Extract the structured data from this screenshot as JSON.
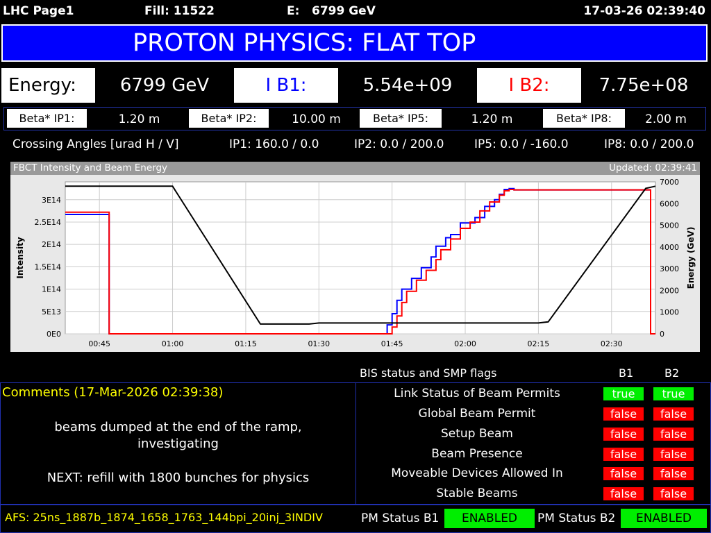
{
  "header": {
    "page": "LHC Page1",
    "fill": "Fill: 11522",
    "energy_label": "E:",
    "energy_value": "6799 GeV",
    "datetime": "17-03-26 02:39:40"
  },
  "title": "PROTON PHYSICS: FLAT TOP",
  "energy_row": {
    "energy_label": "Energy:",
    "energy_value": "6799 GeV",
    "ib1_label": "I B1:",
    "ib1_value": "5.54e+09",
    "ib2_label": "I B2:",
    "ib2_value": "7.75e+08"
  },
  "beta": [
    {
      "label": "Beta* IP1:",
      "value": "1.20 m"
    },
    {
      "label": "Beta* IP2:",
      "value": "10.00 m"
    },
    {
      "label": "Beta* IP5:",
      "value": "1.20 m"
    },
    {
      "label": "Beta* IP8:",
      "value": "2.00 m"
    }
  ],
  "crossing": {
    "label": "Crossing Angles [urad H / V]",
    "ip1": "IP1: 160.0 / 0.0",
    "ip2": "IP2: 0.0 / 200.0",
    "ip5": "IP5: 0.0 / -160.0",
    "ip8": "IP8: 0.0 / 200.0"
  },
  "chart_header": {
    "title": "FBCT Intensity and Beam Energy",
    "updated": "Updated: 02:39:41"
  },
  "chart_data": {
    "type": "line",
    "xlabel": "",
    "ylabel": "Intensity",
    "y2label": "Energy (GeV)",
    "xlim": [
      "00:38",
      "02:39"
    ],
    "ylim": [
      0,
      340000000000000.0
    ],
    "y2lim": [
      0,
      7000
    ],
    "grid": true,
    "x_ticks": [
      "00:45",
      "01:00",
      "01:15",
      "01:30",
      "01:45",
      "02:00",
      "02:15",
      "02:30"
    ],
    "y_ticks": [
      "0E0",
      "5E13",
      "1E14",
      "1.5E14",
      "2E14",
      "2.5E14",
      "3E14"
    ],
    "y2_ticks": [
      "0",
      "1000",
      "2000",
      "3000",
      "4000",
      "5000",
      "6000",
      "7000"
    ],
    "colors": {
      "b1": "#0000ff",
      "b2": "#ff0000",
      "energy": "#000000"
    },
    "series": [
      {
        "axis": "y",
        "color": "b1",
        "x": [
          "00:38",
          "00:47",
          "00:47",
          "01:44",
          "01:44",
          "01:45",
          "01:45",
          "01:46",
          "01:46",
          "01:47",
          "01:47",
          "01:49",
          "01:49",
          "01:51",
          "01:51",
          "01:53",
          "01:53",
          "01:54",
          "01:54",
          "01:56",
          "01:56",
          "01:57",
          "01:57",
          "01:59",
          "01:59",
          "02:02",
          "02:02",
          "02:04",
          "02:04",
          "02:06",
          "02:06",
          "02:07",
          "02:07",
          "02:08",
          "02:08",
          "02:09",
          "02:09",
          "02:10",
          "02:10",
          "02:38",
          "02:38",
          "02:39"
        ],
        "y": [
          267000000000000.0,
          267000000000000.0,
          0,
          0,
          20000000000000.0,
          20000000000000.0,
          45000000000000.0,
          45000000000000.0,
          75000000000000.0,
          75000000000000.0,
          100000000000000.0,
          100000000000000.0,
          124000000000000.0,
          124000000000000.0,
          148000000000000.0,
          148000000000000.0,
          172000000000000.0,
          172000000000000.0,
          196000000000000.0,
          196000000000000.0,
          215000000000000.0,
          215000000000000.0,
          222000000000000.0,
          222000000000000.0,
          248000000000000.0,
          248000000000000.0,
          260000000000000.0,
          260000000000000.0,
          285000000000000.0,
          285000000000000.0,
          300000000000000.0,
          300000000000000.0,
          312000000000000.0,
          312000000000000.0,
          323000000000000.0,
          323000000000000.0,
          325000000000000.0,
          325000000000000.0,
          322000000000000.0,
          322000000000000.0,
          0,
          0
        ]
      },
      {
        "axis": "y",
        "color": "b2",
        "x": [
          "00:38",
          "00:47",
          "00:47",
          "01:45",
          "01:45",
          "01:46",
          "01:46",
          "01:47",
          "01:47",
          "01:48",
          "01:48",
          "01:50",
          "01:50",
          "01:52",
          "01:52",
          "01:54",
          "01:54",
          "01:55",
          "01:55",
          "01:57",
          "01:57",
          "01:59",
          "01:59",
          "02:01",
          "02:01",
          "02:03",
          "02:03",
          "02:05",
          "02:05",
          "02:07",
          "02:07",
          "02:08",
          "02:08",
          "02:09",
          "02:09",
          "02:10",
          "02:10",
          "02:38",
          "02:38",
          "02:39"
        ],
        "y": [
          272000000000000.0,
          272000000000000.0,
          0,
          0,
          15000000000000.0,
          15000000000000.0,
          40000000000000.0,
          40000000000000.0,
          70000000000000.0,
          70000000000000.0,
          95000000000000.0,
          95000000000000.0,
          120000000000000.0,
          120000000000000.0,
          142000000000000.0,
          142000000000000.0,
          166000000000000.0,
          166000000000000.0,
          188000000000000.0,
          188000000000000.0,
          212000000000000.0,
          212000000000000.0,
          236000000000000.0,
          236000000000000.0,
          250000000000000.0,
          250000000000000.0,
          275000000000000.0,
          275000000000000.0,
          295000000000000.0,
          295000000000000.0,
          310000000000000.0,
          310000000000000.0,
          320000000000000.0,
          320000000000000.0,
          323000000000000.0,
          323000000000000.0,
          322000000000000.0,
          322000000000000.0,
          0,
          0
        ]
      },
      {
        "axis": "y2",
        "color": "energy",
        "x": [
          "00:38",
          "01:00",
          "01:18",
          "01:28",
          "01:30",
          "02:15",
          "02:17",
          "02:37",
          "02:39"
        ],
        "y": [
          6800,
          6800,
          450,
          450,
          500,
          500,
          550,
          6700,
          6800
        ]
      }
    ]
  },
  "smp": {
    "title": "BIS status and SMP flags",
    "b1": "B1",
    "b2": "B2",
    "rows": [
      {
        "label": "Link Status of Beam Permits",
        "b1": "true",
        "b2": "true"
      },
      {
        "label": "Global Beam Permit",
        "b1": "false",
        "b2": "false"
      },
      {
        "label": "Setup Beam",
        "b1": "false",
        "b2": "false"
      },
      {
        "label": "Beam Presence",
        "b1": "false",
        "b2": "false"
      },
      {
        "label": "Moveable Devices Allowed In",
        "b1": "false",
        "b2": "false"
      },
      {
        "label": "Stable Beams",
        "b1": "false",
        "b2": "false"
      }
    ]
  },
  "comments": {
    "title": "Comments (17-Mar-2026 02:39:38)",
    "line1": "beams dumped at the end of the ramp,",
    "line2": "investigating",
    "line3": "NEXT: refill with 1800 bunches for physics"
  },
  "footer": {
    "afs": "AFS: 25ns_1887b_1874_1658_1763_144bpi_20inj_3INDIV",
    "pm_b1_label": "PM Status B1",
    "pm_b1_value": "ENABLED",
    "pm_b2_label": "PM Status B2",
    "pm_b2_value": "ENABLED"
  }
}
